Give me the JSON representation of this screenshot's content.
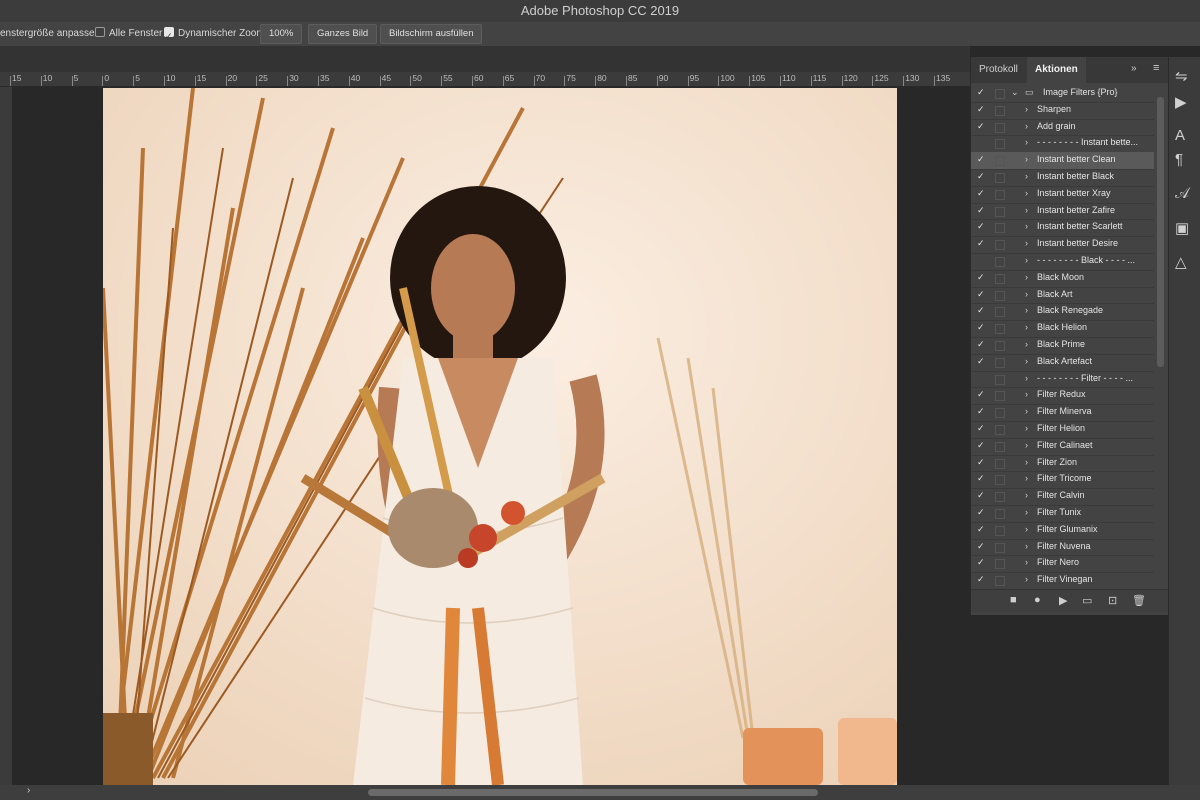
{
  "window": {
    "title": "Adobe Photoshop CC 2019"
  },
  "options_bar": {
    "fit_window_label": "enstergröße anpassen",
    "all_windows_label": "Alle Fenster",
    "dynamic_zoom_label": "Dynamischer Zoom",
    "zoom_value": "100%",
    "fit_screen_label": "Ganzes Bild",
    "fill_screen_label": "Bildschirm ausfüllen"
  },
  "ruler": {
    "labels": [
      "15",
      "10",
      "5",
      "0",
      "5",
      "10",
      "15",
      "20",
      "25",
      "30",
      "35",
      "40",
      "45",
      "50",
      "55",
      "60",
      "65",
      "70",
      "75",
      "80",
      "85",
      "90",
      "95",
      "100",
      "105",
      "110",
      "115",
      "120",
      "125",
      "130",
      "135"
    ]
  },
  "panel": {
    "tabs": [
      {
        "label": "Protokoll"
      },
      {
        "label": "Aktionen"
      }
    ],
    "items": [
      {
        "label": "Image Filters {Pro}",
        "checked": true,
        "type": "set"
      },
      {
        "label": "Sharpen",
        "checked": true
      },
      {
        "label": "Add grain",
        "checked": true
      },
      {
        "label": "- - - - - - - - Instant bette...",
        "checked": false
      },
      {
        "label": "Instant better Clean",
        "checked": true,
        "selected": true
      },
      {
        "label": "Instant better Black",
        "checked": true
      },
      {
        "label": "Instant better Xray",
        "checked": true
      },
      {
        "label": "Instant better Zafire",
        "checked": true
      },
      {
        "label": "Instant better Scarlett",
        "checked": true
      },
      {
        "label": "Instant better Desire",
        "checked": true
      },
      {
        "label": "- - - - - - - - Black - - - - ...",
        "checked": false
      },
      {
        "label": "Black Moon",
        "checked": true
      },
      {
        "label": "Black Art",
        "checked": true
      },
      {
        "label": "Black Renegade",
        "checked": true
      },
      {
        "label": "Black Helion",
        "checked": true
      },
      {
        "label": "Black Prime",
        "checked": true
      },
      {
        "label": "Black Artefact",
        "checked": true
      },
      {
        "label": "- - - - - - - - Filter - - - - ...",
        "checked": false
      },
      {
        "label": "Filter Redux",
        "checked": true
      },
      {
        "label": "Filter Minerva",
        "checked": true
      },
      {
        "label": "Filter Helion",
        "checked": true
      },
      {
        "label": "Filter Calinaet",
        "checked": true
      },
      {
        "label": "Filter Zion",
        "checked": true
      },
      {
        "label": "Filter Tricome",
        "checked": true
      },
      {
        "label": "Filter Calvin",
        "checked": true
      },
      {
        "label": "Filter Tunix",
        "checked": true
      },
      {
        "label": "Filter Glumanix",
        "checked": true
      },
      {
        "label": "Filter Nuvena",
        "checked": true
      },
      {
        "label": "Filter Nero",
        "checked": true
      },
      {
        "label": "Filter Vinegan",
        "checked": true
      }
    ],
    "footer_icons": [
      "stop-icon",
      "record-icon",
      "play-icon",
      "folder-icon",
      "new-action-icon",
      "trash-icon"
    ]
  },
  "colors": {
    "accent_bg": "#434343",
    "photo_wall": "#f1dcc8",
    "selected_row": "#5a5a5a"
  }
}
